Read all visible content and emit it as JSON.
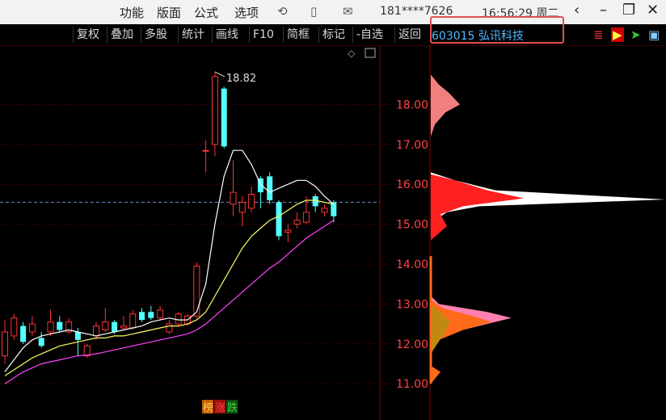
{
  "menu": [
    "功能",
    "版面",
    "公式",
    "选项"
  ],
  "phone": "181****7626",
  "time": "16:56:29 周二",
  "toolbar": [
    "复权",
    "叠加",
    "多股",
    "统计",
    "画线",
    "F10",
    "简框",
    "标记",
    "-自选",
    "返回"
  ],
  "stock": {
    "code": "603015",
    "name": "弘讯科技"
  },
  "colors": {
    "up": "#ff3232",
    "down": "#54ffff",
    "ma5": "#ffffff",
    "ma10": "#ffff66",
    "ma20": "#ff44ff",
    "accent": "#e05050"
  },
  "chart_data": {
    "type": "candlestick",
    "ylim": [
      10.7,
      19.0
    ],
    "yticks": [
      "18.00",
      "17.00",
      "16.00",
      "15.00",
      "14.00",
      "13.00",
      "12.00",
      "11.00"
    ],
    "ytick_values": [
      18,
      17,
      16,
      15,
      14,
      13,
      12,
      11
    ],
    "max_label": "18.82",
    "last_price_line": 15.55,
    "candles": [
      {
        "o": 11.7,
        "c": 12.3,
        "h": 12.6,
        "l": 11.5
      },
      {
        "o": 12.2,
        "c": 12.65,
        "h": 12.75,
        "l": 12.1
      },
      {
        "o": 12.45,
        "c": 12.05,
        "h": 12.55,
        "l": 12.0
      },
      {
        "o": 12.3,
        "c": 12.5,
        "h": 12.7,
        "l": 12.2
      },
      {
        "o": 12.15,
        "c": 11.95,
        "h": 12.3,
        "l": 11.9
      },
      {
        "o": 12.3,
        "c": 12.55,
        "h": 12.85,
        "l": 12.2
      },
      {
        "o": 12.55,
        "c": 12.35,
        "h": 12.7,
        "l": 12.3
      },
      {
        "o": 12.3,
        "c": 12.55,
        "h": 12.65,
        "l": 12.25
      },
      {
        "o": 12.3,
        "c": 12.1,
        "h": 12.4,
        "l": 11.7
      },
      {
        "o": 11.7,
        "c": 11.95,
        "h": 12.0,
        "l": 11.65
      },
      {
        "o": 12.2,
        "c": 12.45,
        "h": 12.55,
        "l": 12.1
      },
      {
        "o": 12.35,
        "c": 12.55,
        "h": 12.9,
        "l": 12.3
      },
      {
        "o": 12.55,
        "c": 12.3,
        "h": 12.6,
        "l": 12.25
      },
      {
        "o": 12.4,
        "c": 12.45,
        "h": 12.7,
        "l": 12.35
      },
      {
        "o": 12.4,
        "c": 12.75,
        "h": 12.85,
        "l": 12.35
      },
      {
        "o": 12.8,
        "c": 12.6,
        "h": 12.9,
        "l": 12.55
      },
      {
        "o": 12.8,
        "c": 12.65,
        "h": 12.95,
        "l": 12.6
      },
      {
        "o": 12.65,
        "c": 12.85,
        "h": 12.95,
        "l": 12.6
      },
      {
        "o": 12.3,
        "c": 12.5,
        "h": 12.6,
        "l": 12.25
      },
      {
        "o": 12.5,
        "c": 12.75,
        "h": 12.8,
        "l": 12.45
      },
      {
        "o": 12.5,
        "c": 12.7,
        "h": 12.75,
        "l": 12.45
      },
      {
        "o": 12.7,
        "c": 13.95,
        "h": 14.05,
        "l": 12.65
      },
      {
        "o": 16.85,
        "c": 16.85,
        "h": 17.1,
        "l": 16.3
      },
      {
        "o": 17.0,
        "c": 18.7,
        "h": 18.82,
        "l": 16.7
      },
      {
        "o": 18.4,
        "c": 16.95,
        "h": 18.45,
        "l": 16.9
      },
      {
        "o": 15.5,
        "c": 15.8,
        "h": 16.6,
        "l": 15.2
      },
      {
        "o": 15.3,
        "c": 15.55,
        "h": 15.7,
        "l": 14.95
      },
      {
        "o": 15.4,
        "c": 15.75,
        "h": 15.95,
        "l": 15.3
      },
      {
        "o": 16.15,
        "c": 15.8,
        "h": 16.2,
        "l": 15.4
      },
      {
        "o": 16.2,
        "c": 15.6,
        "h": 16.3,
        "l": 15.5
      },
      {
        "o": 15.55,
        "c": 14.7,
        "h": 15.6,
        "l": 14.6
      },
      {
        "o": 14.8,
        "c": 14.85,
        "h": 15.0,
        "l": 14.55
      },
      {
        "o": 15.0,
        "c": 15.1,
        "h": 15.3,
        "l": 14.9
      },
      {
        "o": 15.05,
        "c": 15.3,
        "h": 15.7,
        "l": 15.0
      },
      {
        "o": 15.7,
        "c": 15.45,
        "h": 15.75,
        "l": 15.3
      },
      {
        "o": 15.3,
        "c": 15.4,
        "h": 15.5,
        "l": 15.2
      },
      {
        "o": 15.55,
        "c": 15.2,
        "h": 15.6,
        "l": 15.05
      }
    ],
    "ma5": [
      11.3,
      11.6,
      11.9,
      12.1,
      12.2,
      12.25,
      12.3,
      12.35,
      12.3,
      12.25,
      12.2,
      12.25,
      12.3,
      12.35,
      12.4,
      12.45,
      12.55,
      12.6,
      12.65,
      12.6,
      12.6,
      12.8,
      13.5,
      15.0,
      16.2,
      16.85,
      16.85,
      16.5,
      16.0,
      15.8,
      15.9,
      16.0,
      16.1,
      16.1,
      15.95,
      15.7,
      15.5
    ],
    "ma10": [
      11.2,
      11.35,
      11.5,
      11.65,
      11.75,
      11.85,
      11.95,
      12.0,
      12.05,
      12.1,
      12.15,
      12.15,
      12.2,
      12.2,
      12.25,
      12.3,
      12.35,
      12.4,
      12.45,
      12.45,
      12.5,
      12.6,
      12.8,
      13.2,
      13.6,
      14.0,
      14.4,
      14.7,
      14.9,
      15.1,
      15.2,
      15.35,
      15.5,
      15.6,
      15.6,
      15.55,
      15.5
    ],
    "ma20": [
      11.0,
      11.15,
      11.3,
      11.4,
      11.5,
      11.55,
      11.6,
      11.65,
      11.7,
      11.72,
      11.75,
      11.8,
      11.85,
      11.9,
      11.95,
      12.0,
      12.05,
      12.1,
      12.15,
      12.2,
      12.25,
      12.35,
      12.5,
      12.7,
      12.9,
      13.1,
      13.3,
      13.5,
      13.7,
      13.9,
      14.05,
      14.25,
      14.45,
      14.65,
      14.8,
      14.95,
      15.1
    ],
    "badges": [
      "榜",
      "涨",
      "跌"
    ]
  }
}
